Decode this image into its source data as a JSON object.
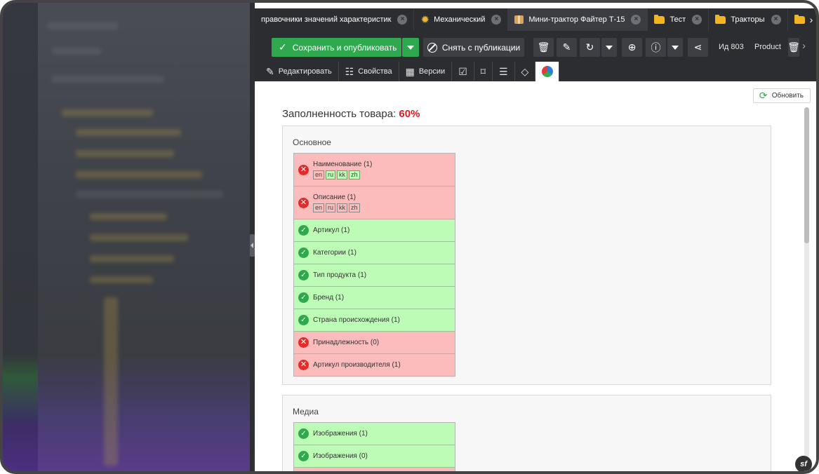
{
  "tabs": [
    {
      "label": "правочники значений характеристик",
      "icon": "none-icon"
    },
    {
      "label": "Механический",
      "icon": "gear-icon"
    },
    {
      "label": "Мини-трактор Файтер Т-15",
      "icon": "package-icon"
    },
    {
      "label": "Тест",
      "icon": "folder-icon"
    },
    {
      "label": "Тракторы",
      "icon": "folder-icon"
    }
  ],
  "toolbar": {
    "save_label": "Сохранить и опубликовать",
    "unpublish_label": "Снять с публикации",
    "id_label": "Ид 803",
    "type_label": "Product"
  },
  "subtabs": {
    "edit_label": "Редактировать",
    "properties_label": "Свойства",
    "versions_label": "Версии"
  },
  "content": {
    "refresh_label": "Обновить",
    "completeness_label": "Заполненность товара:",
    "completeness_value": "60%"
  },
  "sections": {
    "basic": {
      "title": "Основное",
      "items": [
        {
          "label": "Наименование (1)",
          "status": "bad",
          "langs": [
            {
              "code": "en",
              "on": false
            },
            {
              "code": "ru",
              "on": true
            },
            {
              "code": "kk",
              "on": true
            },
            {
              "code": "zh",
              "on": true
            }
          ]
        },
        {
          "label": "Описание (1)",
          "status": "bad",
          "langs": [
            {
              "code": "en",
              "on": false
            },
            {
              "code": "ru",
              "on": false
            },
            {
              "code": "kk",
              "on": false
            },
            {
              "code": "zh",
              "on": false
            }
          ]
        },
        {
          "label": "Артикул (1)",
          "status": "ok"
        },
        {
          "label": "Категории (1)",
          "status": "ok"
        },
        {
          "label": "Тип продукта (1)",
          "status": "ok"
        },
        {
          "label": "Бренд (1)",
          "status": "ok"
        },
        {
          "label": "Страна происхождения (1)",
          "status": "ok"
        },
        {
          "label": "Принадлежность (0)",
          "status": "bad"
        },
        {
          "label": "Артикул производителя (1)",
          "status": "bad"
        }
      ]
    },
    "media": {
      "title": "Медиа",
      "items": [
        {
          "label": "Изображения (1)",
          "status": "ok"
        },
        {
          "label": "Изображения (0)",
          "status": "ok"
        },
        {
          "label": "",
          "status": "bad"
        }
      ]
    }
  },
  "colors": {
    "accent_green": "#2fa84f",
    "error_red": "#e32b2b",
    "ok_bg": "#bcfcb6",
    "bad_bg": "#fcbcbc",
    "dark_toolbar": "#2b2d31"
  }
}
